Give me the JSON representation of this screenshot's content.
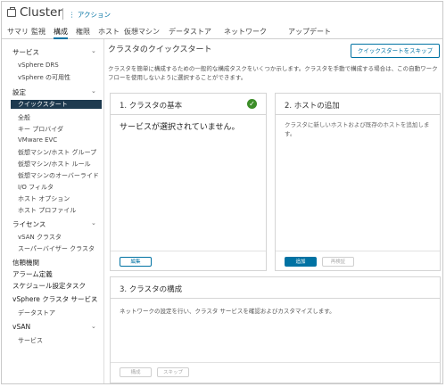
{
  "header": {
    "title": "Cluster",
    "actions_label": "⋮ アクション"
  },
  "tabs": [
    "サマリ",
    "監視",
    "構成",
    "権限",
    "ホスト",
    "仮想マシン",
    "データストア",
    "ネットワーク",
    "アップデート"
  ],
  "active_tab": "構成",
  "sidebar": {
    "services": "サービス",
    "drs": "vSphere DRS",
    "availability": "vSphere の可用性",
    "settings": "設定",
    "quickstart": "クイックスタート",
    "general": "全般",
    "keyprovider": "キー プロバイダ",
    "evc": "VMware EVC",
    "vmhostgroups": "仮想マシン/ホスト グループ",
    "vmhostrules": "仮想マシン/ホスト ルール",
    "vmoverrides": "仮想マシンのオーバーライド",
    "iofilters": "I/O フィルタ",
    "hostoptions": "ホスト オプション",
    "hostprofile": "ホスト プロファイル",
    "licensing": "ライセンス",
    "vsancluster": "vSAN クラスタ",
    "supervisor": "スーパーバイザー クラスタ",
    "trusthub": "信頼機関",
    "alarms": "アラーム定義",
    "scheduled": "スケジュール設定タスク",
    "vsphereclustersvc": "vSphere クラスタ サービス",
    "datastores": "データストア",
    "vsan": "vSAN",
    "vsanservices": "サービス"
  },
  "main": {
    "title": "クラスタのクイックスタート",
    "skip_button": "クイックスタートをスキップ",
    "description": "クラスタを簡単に構成するための一般的な構成タスクをいくつか示します。クラスタを手動で構成する場合は、この自動ワークフローを使用しないように選択することができます。",
    "card1": {
      "title": "1. クラスタの基本",
      "message": "サービスが選択されていません。",
      "edit_button": "編集"
    },
    "card2": {
      "title": "2. ホストの追加",
      "description": "クラスタに新しいホストおよび既存のホストを追加します。",
      "add_button": "追加",
      "revalidate_button": "再検証"
    },
    "card3": {
      "title": "3. クラスタの構成",
      "description": "ネットワークの設定を行い、クラスタ サービスを確認およびカスタマイズします。",
      "configure_button": "構成",
      "skip_button": "スキップ"
    }
  },
  "colors": {
    "accent": "#0072a3",
    "selected_bg": "#1e3a4f",
    "success": "#3c8d28"
  }
}
